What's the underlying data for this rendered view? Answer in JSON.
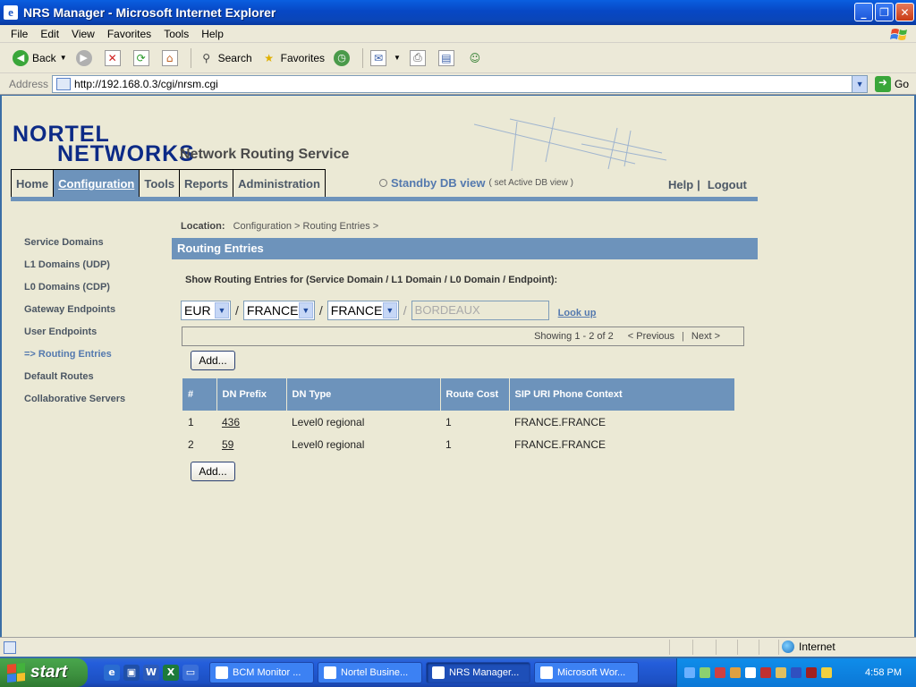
{
  "window": {
    "title": "NRS Manager - Microsoft Internet Explorer"
  },
  "menu": [
    "File",
    "Edit",
    "View",
    "Favorites",
    "Tools",
    "Help"
  ],
  "toolbar": {
    "back": "Back",
    "search": "Search",
    "favorites": "Favorites"
  },
  "address": {
    "label": "Address",
    "url": "http://192.168.0.3/cgi/nrsm.cgi",
    "go": "Go"
  },
  "brand": {
    "logo_line1": "NORTEL",
    "logo_line2": "NETWORKS",
    "service": "Network Routing Service"
  },
  "nav": {
    "tabs": [
      "Home",
      "Configuration",
      "Tools",
      "Reports",
      "Administration"
    ],
    "active": "Configuration"
  },
  "db": {
    "standby": "Standby DB view",
    "set_active": "( set Active DB view )"
  },
  "links": {
    "help": "Help",
    "separator": "|",
    "logout": "Logout"
  },
  "sidebar": {
    "items": [
      "Service Domains",
      "L1 Domains (UDP)",
      "L0 Domains (CDP)",
      "Gateway Endpoints",
      "User Endpoints",
      "=> Routing Entries",
      "Default Routes",
      "Collaborative Servers"
    ]
  },
  "location": {
    "label": "Location:",
    "path": "Configuration > Routing Entries >"
  },
  "section": {
    "title": "Routing Entries"
  },
  "filter": {
    "label": "Show Routing Entries for (Service Domain / L1 Domain / L0 Domain / Endpoint):",
    "service_domain": "EUR",
    "l1_domain": "FRANCE",
    "l0_domain": "FRANCE",
    "separator": "/",
    "endpoint_placeholder": "BORDEAUX",
    "lookup": "Look up"
  },
  "pager": {
    "showing": "Showing 1 - 2 of 2",
    "previous": "< Previous",
    "separator": "|",
    "next": "Next >"
  },
  "buttons": {
    "add": "Add..."
  },
  "table": {
    "headers": [
      "#",
      "DN Prefix",
      "DN Type",
      "Route Cost",
      "SIP URI Phone Context"
    ],
    "rows": [
      {
        "num": "1",
        "prefix": "436",
        "type": "Level0 regional",
        "cost": "1",
        "context": "FRANCE.FRANCE"
      },
      {
        "num": "2",
        "prefix": "59",
        "type": "Level0 regional",
        "cost": "1",
        "context": "FRANCE.FRANCE"
      }
    ]
  },
  "status": {
    "zone": "Internet"
  },
  "taskbar": {
    "start": "start",
    "tasks": [
      "BCM Monitor ...",
      "Nortel Busine...",
      "NRS Manager...",
      "Microsoft Wor..."
    ],
    "active_task": "NRS Manager...",
    "clock": "4:58 PM"
  },
  "colors": {
    "accent": "#6d93bb",
    "page_bg": "#ebe9d5",
    "logo": "#0c2a86",
    "link": "#5479ae"
  }
}
